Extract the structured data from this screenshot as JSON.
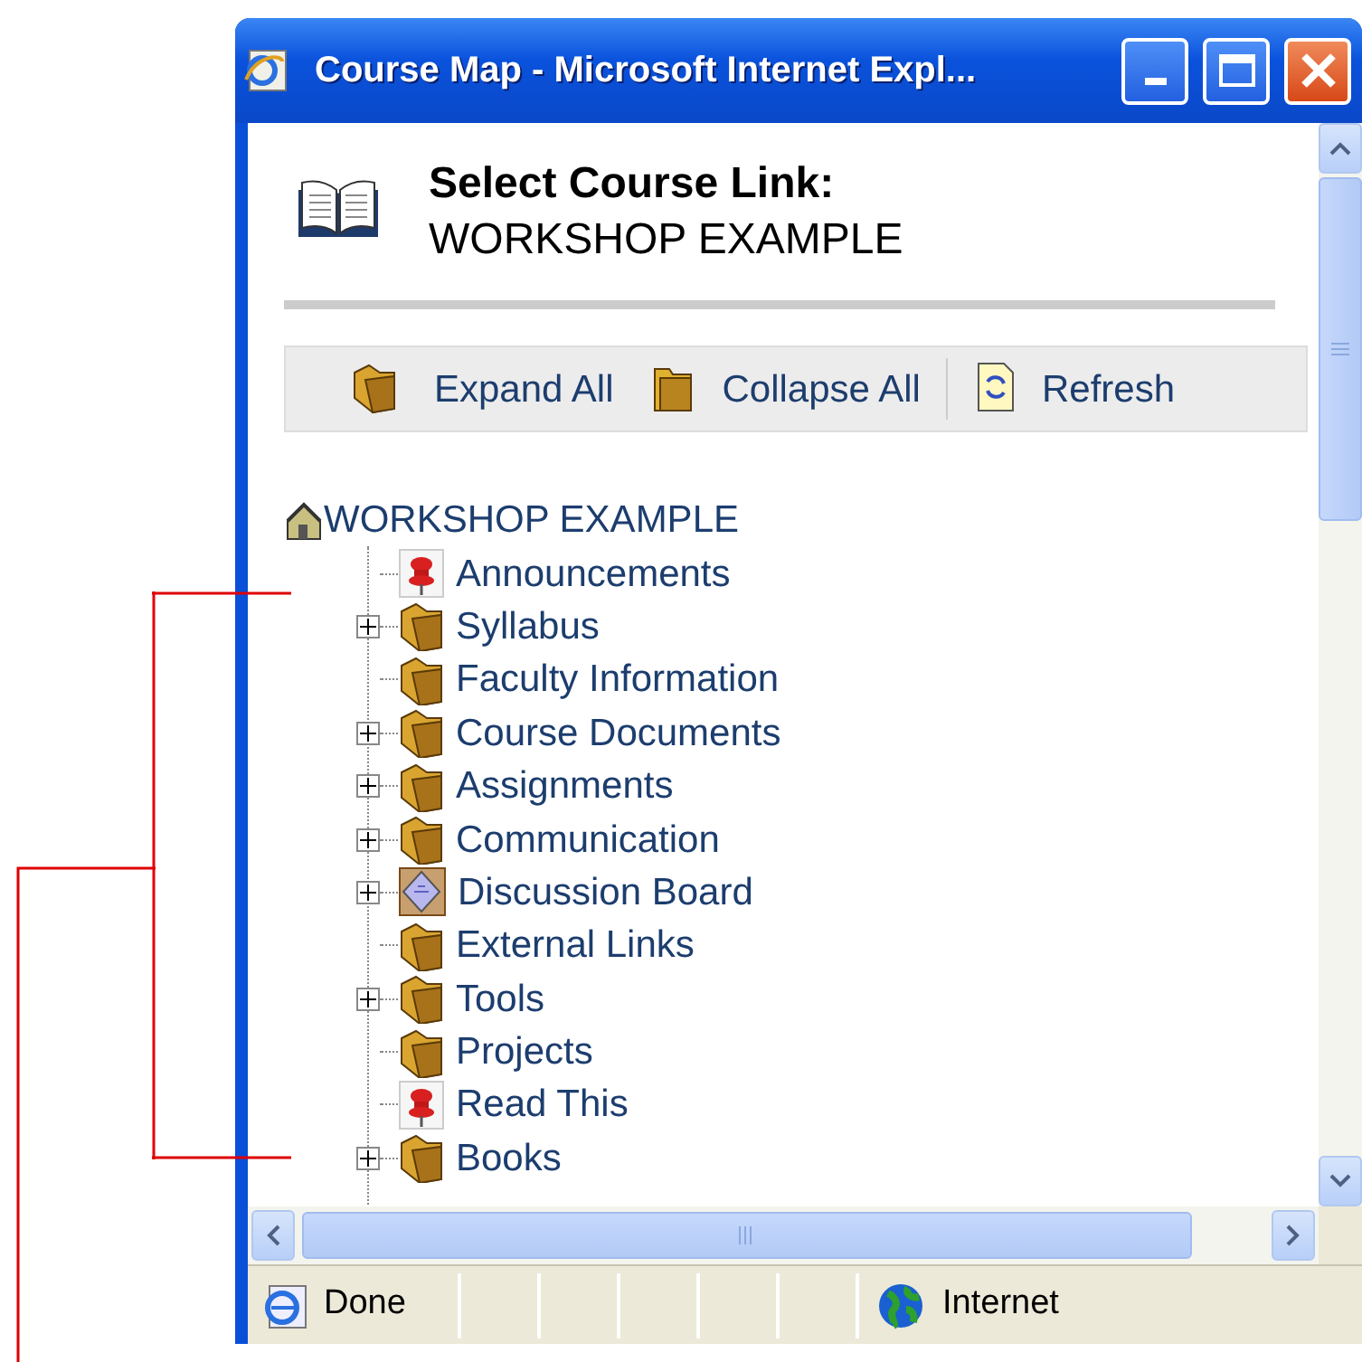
{
  "window": {
    "title": "Course Map - Microsoft Internet Expl..."
  },
  "header": {
    "title": "Select Course Link:",
    "subtitle": "WORKSHOP EXAMPLE"
  },
  "toolbar": [
    {
      "kind": "expand",
      "label": "Expand All"
    },
    {
      "kind": "collapse",
      "label": "Collapse All"
    },
    {
      "kind": "refresh",
      "label": "Refresh"
    }
  ],
  "tree": {
    "label": "WORKSHOP EXAMPLE",
    "children": [
      {
        "label": "Announcements",
        "kind": "pin",
        "expandable": false
      },
      {
        "label": "Syllabus",
        "kind": "folder",
        "expandable": true
      },
      {
        "label": "Faculty Information",
        "kind": "folder",
        "expandable": false
      },
      {
        "label": "Course Documents",
        "kind": "folder",
        "expandable": true
      },
      {
        "label": "Assignments",
        "kind": "folder",
        "expandable": true
      },
      {
        "label": "Communication",
        "kind": "folder",
        "expandable": true
      },
      {
        "label": "Discussion Board",
        "kind": "board",
        "expandable": true
      },
      {
        "label": "External Links",
        "kind": "folder",
        "expandable": false
      },
      {
        "label": "Tools",
        "kind": "folder",
        "expandable": true
      },
      {
        "label": "Projects",
        "kind": "folder",
        "expandable": false
      },
      {
        "label": "Read This",
        "kind": "pin",
        "expandable": false
      },
      {
        "label": "Books",
        "kind": "folder",
        "expandable": true
      }
    ]
  },
  "status_bar": {
    "status": "Done",
    "zone": "Internet"
  }
}
